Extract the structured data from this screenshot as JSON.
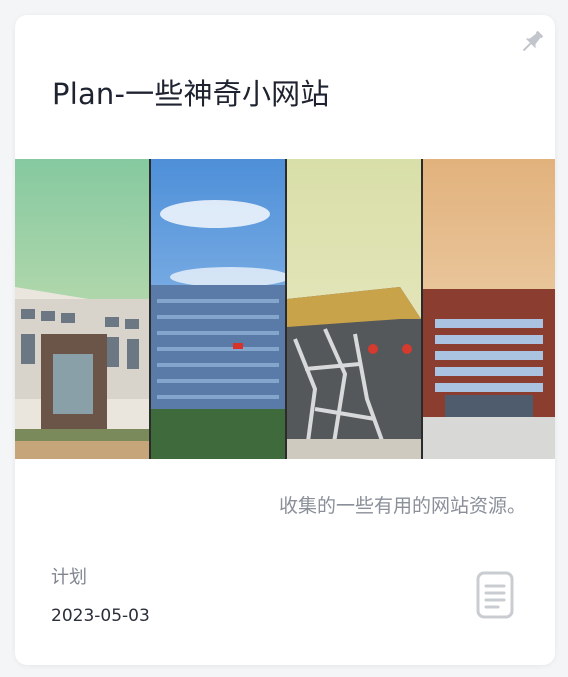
{
  "card": {
    "title": "Plan-一些神奇小网站",
    "description": "收集的一些有用的网站资源。",
    "category": "计划",
    "date": "2023-05-03"
  },
  "icons": {
    "pin": "pin-icon",
    "document": "document-icon"
  },
  "colors": {
    "card_bg": "#ffffff",
    "page_bg": "#f3f5f7",
    "title": "#1f2330",
    "muted": "#8a8f99"
  }
}
